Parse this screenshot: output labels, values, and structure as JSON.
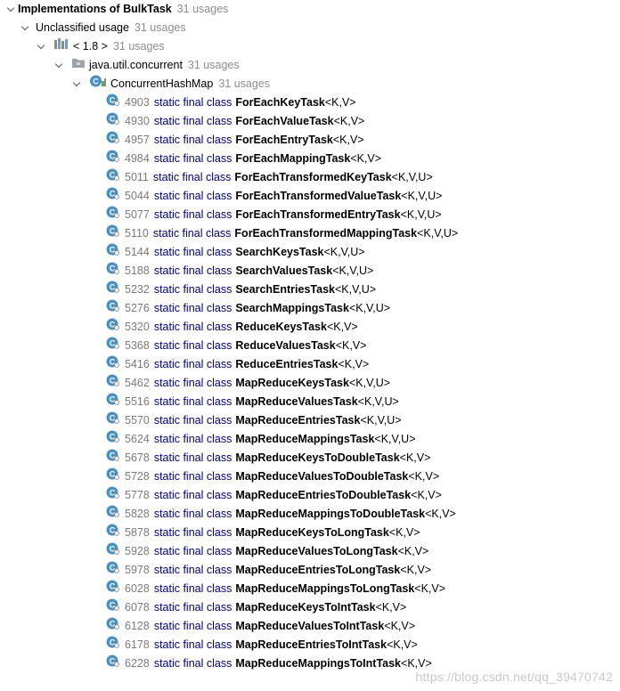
{
  "root": {
    "title": "Implementations of BulkTask",
    "usages": "31 usages"
  },
  "group": {
    "label": "Unclassified usage",
    "usages": "31 usages"
  },
  "library": {
    "label": "< 1.8 >",
    "usages": "31 usages"
  },
  "package": {
    "label": "java.util.concurrent",
    "usages": "31 usages"
  },
  "outer_class": {
    "label": "ConcurrentHashMap",
    "usages": "31 usages"
  },
  "keywords": "static final class",
  "items": [
    {
      "line": "4903",
      "name": "ForEachKeyTask",
      "generics": "<K,V>"
    },
    {
      "line": "4930",
      "name": "ForEachValueTask",
      "generics": "<K,V>"
    },
    {
      "line": "4957",
      "name": "ForEachEntryTask",
      "generics": "<K,V>"
    },
    {
      "line": "4984",
      "name": "ForEachMappingTask",
      "generics": "<K,V>"
    },
    {
      "line": "5011",
      "name": "ForEachTransformedKeyTask",
      "generics": "<K,V,U>"
    },
    {
      "line": "5044",
      "name": "ForEachTransformedValueTask",
      "generics": "<K,V,U>"
    },
    {
      "line": "5077",
      "name": "ForEachTransformedEntryTask",
      "generics": "<K,V,U>"
    },
    {
      "line": "5110",
      "name": "ForEachTransformedMappingTask",
      "generics": "<K,V,U>"
    },
    {
      "line": "5144",
      "name": "SearchKeysTask",
      "generics": "<K,V,U>"
    },
    {
      "line": "5188",
      "name": "SearchValuesTask",
      "generics": "<K,V,U>"
    },
    {
      "line": "5232",
      "name": "SearchEntriesTask",
      "generics": "<K,V,U>"
    },
    {
      "line": "5276",
      "name": "SearchMappingsTask",
      "generics": "<K,V,U>"
    },
    {
      "line": "5320",
      "name": "ReduceKeysTask",
      "generics": "<K,V>"
    },
    {
      "line": "5368",
      "name": "ReduceValuesTask",
      "generics": "<K,V>"
    },
    {
      "line": "5416",
      "name": "ReduceEntriesTask",
      "generics": "<K,V>"
    },
    {
      "line": "5462",
      "name": "MapReduceKeysTask",
      "generics": "<K,V,U>"
    },
    {
      "line": "5516",
      "name": "MapReduceValuesTask",
      "generics": "<K,V,U>"
    },
    {
      "line": "5570",
      "name": "MapReduceEntriesTask",
      "generics": "<K,V,U>"
    },
    {
      "line": "5624",
      "name": "MapReduceMappingsTask",
      "generics": "<K,V,U>"
    },
    {
      "line": "5678",
      "name": "MapReduceKeysToDoubleTask",
      "generics": "<K,V>"
    },
    {
      "line": "5728",
      "name": "MapReduceValuesToDoubleTask",
      "generics": "<K,V>"
    },
    {
      "line": "5778",
      "name": "MapReduceEntriesToDoubleTask",
      "generics": "<K,V>"
    },
    {
      "line": "5828",
      "name": "MapReduceMappingsToDoubleTask",
      "generics": "<K,V>"
    },
    {
      "line": "5878",
      "name": "MapReduceKeysToLongTask",
      "generics": "<K,V>"
    },
    {
      "line": "5928",
      "name": "MapReduceValuesToLongTask",
      "generics": "<K,V>"
    },
    {
      "line": "5978",
      "name": "MapReduceEntriesToLongTask",
      "generics": "<K,V>"
    },
    {
      "line": "6028",
      "name": "MapReduceMappingsToLongTask",
      "generics": "<K,V>"
    },
    {
      "line": "6078",
      "name": "MapReduceKeysToIntTask",
      "generics": "<K,V>"
    },
    {
      "line": "6128",
      "name": "MapReduceValuesToIntTask",
      "generics": "<K,V>"
    },
    {
      "line": "6178",
      "name": "MapReduceEntriesToIntTask",
      "generics": "<K,V>"
    },
    {
      "line": "6228",
      "name": "MapReduceMappingsToIntTask",
      "generics": "<K,V>"
    }
  ],
  "watermark": "https://blog.csdn.net/qq_39470742",
  "colors": {
    "keyword": "#000080",
    "usages": "#8c8c8c",
    "line_number": "#7a7a7a",
    "class_icon": "#4a90c2",
    "folder_icon": "#9aa3ab"
  }
}
